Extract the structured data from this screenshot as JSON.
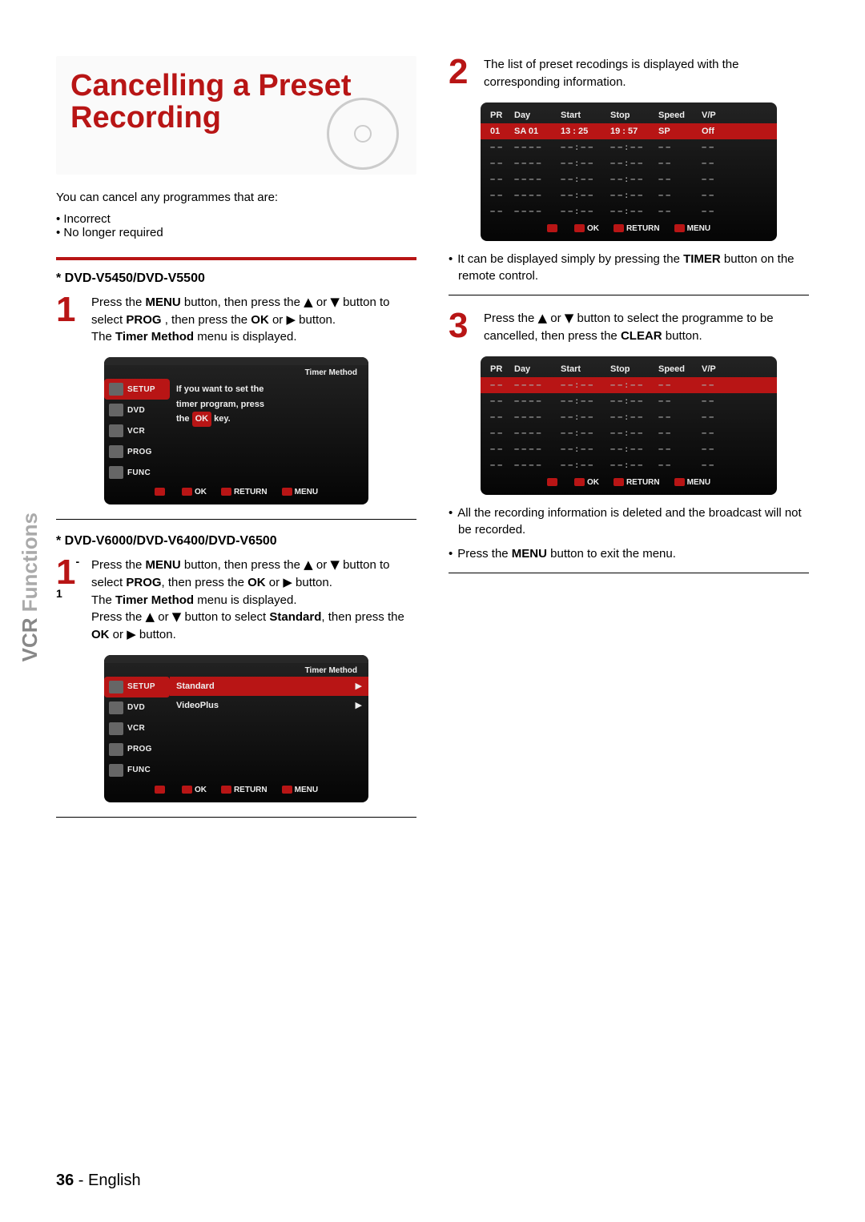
{
  "side_label": {
    "accent": "VCR",
    "rest": "Functions"
  },
  "footer": {
    "num": "36",
    "sep": " - ",
    "lang": "English"
  },
  "title": "Cancelling a Preset Recording",
  "intro": "You can cancel any programmes that are:",
  "intro_bullets": [
    "Incorrect",
    "No longer required"
  ],
  "section1": {
    "header": "* DVD-V5450/DVD-V5500",
    "step_num": "1",
    "text_parts": {
      "a": "Press the ",
      "menu": "MENU",
      "b": " button, then press the ",
      "up": "▲",
      "or1": " or ",
      "down": "▼",
      "c": " button to select ",
      "prog": "PROG",
      "d": " , then press the ",
      "ok": "OK",
      "or2": " or ",
      "right": "▶",
      "e": " button.",
      "f": "The ",
      "tm": "Timer Method",
      "g": " menu is displayed."
    },
    "osd": {
      "title": "Timer Method",
      "sidebar": [
        "SETUP",
        "DVD",
        "VCR",
        "PROG",
        "FUNC"
      ],
      "main1": "If you want to set the",
      "main2": "timer program, press",
      "main3_a": "the ",
      "main3_key": "OK",
      "main3_b": " key.",
      "foot": {
        "ok": "OK",
        "return": "RETURN",
        "menu": "MENU"
      }
    }
  },
  "section2": {
    "header": "* DVD-V6000/DVD-V6400/DVD-V6500",
    "step_num": "1",
    "sub": "-1",
    "text_parts": {
      "a": "Press the ",
      "menu": "MENU",
      "b": " button, then press the ",
      "up": "▲",
      "or1": " or ",
      "down": "▼",
      "c": " button to select ",
      "prog": "PROG",
      "d": ", then press the ",
      "ok": "OK",
      "or2": " or ",
      "right": "▶",
      "e": " button.",
      "f": "The ",
      "tm": "Timer Method",
      "g": " menu is displayed.",
      "h": "Press the ",
      "up2": "▲",
      "or3": " or ",
      "down2": "▼",
      "i": " button to select ",
      "std": "Standard",
      "j": ", then press the ",
      "ok2": "OK",
      "or4": " or ",
      "right2": "▶",
      "k": " button."
    },
    "osd": {
      "title": "Timer Method",
      "sidebar": [
        "SETUP",
        "DVD",
        "VCR",
        "PROG",
        "FUNC"
      ],
      "rows": [
        {
          "label": "Standard",
          "arrow": "▶"
        },
        {
          "label": "VideoPlus",
          "arrow": "▶"
        }
      ],
      "foot": {
        "ok": "OK",
        "return": "RETURN",
        "menu": "MENU"
      }
    }
  },
  "right_step2": {
    "num": "2",
    "text": "The list of preset recodings is displayed with the corresponding information."
  },
  "right_step2_note": {
    "a": "It can be displayed simply by pressing the ",
    "timer": "TIMER",
    "b": " button on the remote control."
  },
  "right_step3": {
    "num": "3",
    "a": "Press the ",
    "up": "▲",
    "or": " or ",
    "down": "▼",
    "b": " button to select the programme to be cancelled, then press the ",
    "clear": "CLEAR",
    "c": " button."
  },
  "right_step3_notes": [
    "All the recording information is deleted and the broadcast will not be recorded.",
    "Press the MENU button to exit the menu."
  ],
  "table_head": [
    "PR",
    "Day",
    "Start",
    "Stop",
    "Speed",
    "V/P"
  ],
  "table1": {
    "row0": [
      "01",
      "SA  01",
      "13 : 25",
      "19 : 57",
      "SP",
      "Off"
    ],
    "dash_row": [
      "– –",
      "– –   – –",
      "– – : – –",
      "– – : – –",
      "– –",
      "– –"
    ]
  },
  "table_foot": {
    "ok": "OK",
    "return": "RETURN",
    "menu": "MENU"
  }
}
